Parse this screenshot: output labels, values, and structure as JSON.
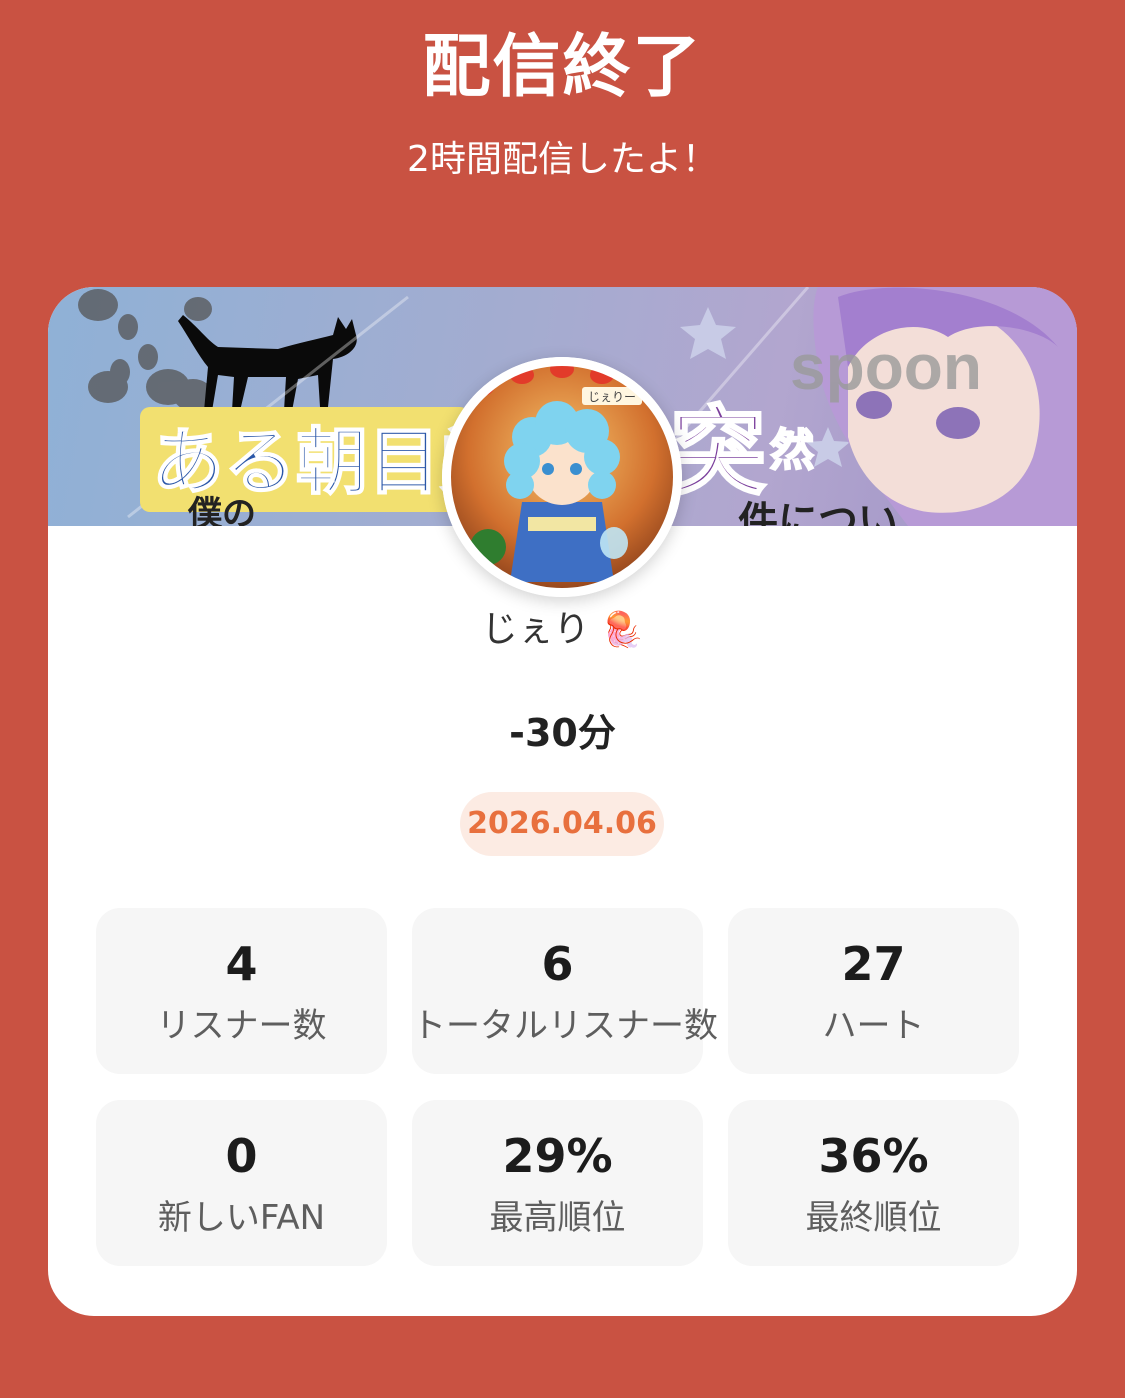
{
  "header": {
    "title": "配信終了",
    "subtitle": "2時間配信したよ！"
  },
  "banner": {
    "text_main": "ある朝目覚",
    "text_right": "突",
    "text_right_small": "然",
    "watermark": "spoon",
    "text_bottom_left": "僕の",
    "text_bottom_right": "件について"
  },
  "profile": {
    "username": "じぇり",
    "username_emoji": "🪼",
    "avatar_caption": "じぇりー"
  },
  "broadcast": {
    "duration": "-30分",
    "date": "2026.04.06"
  },
  "stats": [
    {
      "value": "4",
      "label": "リスナー数"
    },
    {
      "value": "6",
      "label": "トータルリスナー数"
    },
    {
      "value": "27",
      "label": "ハート"
    },
    {
      "value": "0",
      "label": "新しいFAN"
    },
    {
      "value": "29%",
      "label": "最高順位"
    },
    {
      "value": "36%",
      "label": "最終順位"
    }
  ],
  "colors": {
    "background": "#c95242",
    "date_text": "#e8703e",
    "date_bg": "#fcebe3"
  }
}
